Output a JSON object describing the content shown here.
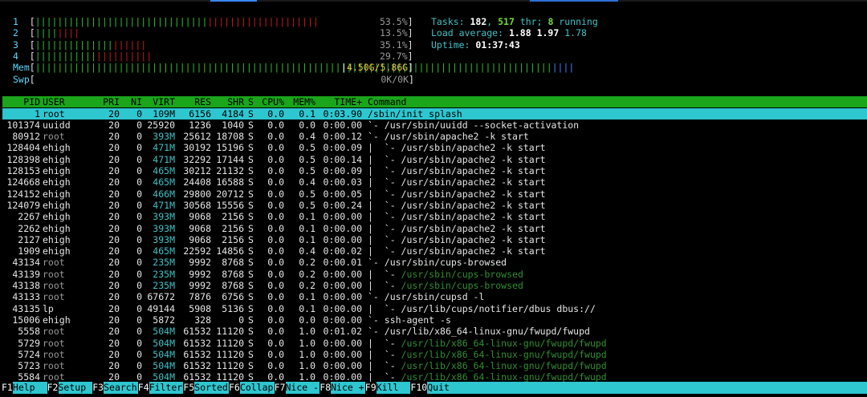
{
  "meters": {
    "cpu1": {
      "label": "1",
      "bars_green": "|||||||||||||||||||||||||||||||",
      "bars_red": "||||||||||||||||||||",
      "pct": "53.5%"
    },
    "cpu2": {
      "label": "2",
      "bars_green": "||||",
      "bars_red": "||||",
      "pct": "13.5%"
    },
    "cpu3": {
      "label": "3",
      "bars_green": "||||||||||||||",
      "bars_red": "||||||",
      "pct": "35.1%"
    },
    "cpu4": {
      "label": "4",
      "bars_green": "|||||||||||",
      "bars_red": "||||||||||",
      "pct": "29.7%"
    },
    "mem": {
      "label": "Mem",
      "bars_green": "|||||||||||||||||||||||||||||||||||||||||||||||||||||||||||||||||||||||||||||||||||||||||||||",
      "bars_blue": "||||",
      "pct": "4.50G/5.86G"
    },
    "swp": {
      "label": "Swp",
      "pct": "0K/0K"
    }
  },
  "summary": {
    "tasks_label": "Tasks: ",
    "tasks": "182",
    "thr_sep": ", ",
    "thr": "517",
    "thr_label": " thr; ",
    "running": "8",
    "running_label": " running",
    "load_label": "Load average: ",
    "load1": "1.88",
    "load5": "1.97",
    "load15": "1.78",
    "uptime_label": "Uptime: ",
    "uptime": "01:37:43"
  },
  "columns": {
    "pid": "PID",
    "user": "USER",
    "pri": "PRI",
    "ni": "NI",
    "virt": "VIRT",
    "res": "RES",
    "shr": "SHR",
    "s": "S",
    "cpu": "CPU%",
    "mem": "MEM%",
    "time": "TIME+",
    "command": "Command"
  },
  "processes": [
    {
      "pid": "1",
      "user": "root",
      "pri": "20",
      "ni": "0",
      "virt": "109M",
      "res": "6156",
      "shr": "4184",
      "s": "S",
      "cpu": "0.0",
      "mem": "0.1",
      "time": "0:03.90",
      "tree": "",
      "cmd": "/sbin/init splash",
      "sel": true
    },
    {
      "pid": "101374",
      "user": "uuidd",
      "pri": "20",
      "ni": "0",
      "virt": "25920",
      "res": "1236",
      "shr": "1040",
      "s": "S",
      "cpu": "0.0",
      "mem": "0.0",
      "time": "0:00.00",
      "tree": "`- ",
      "cmd": "/usr/sbin/uuidd --socket-activation"
    },
    {
      "pid": "80912",
      "user": "root",
      "pri": "20",
      "ni": "0",
      "virt": "393M",
      "res": "25612",
      "shr": "18708",
      "s": "S",
      "cpu": "0.0",
      "mem": "0.4",
      "time": "0:00.12",
      "tree": "`- ",
      "cmd": "/usr/sbin/apache2 -k start"
    },
    {
      "pid": "128404",
      "user": "ehigh",
      "pri": "20",
      "ni": "0",
      "virt": "471M",
      "res": "30192",
      "shr": "15196",
      "s": "S",
      "cpu": "0.0",
      "mem": "0.5",
      "time": "0:00.09",
      "tree": "|  `- ",
      "cmd": "/usr/sbin/apache2 -k start"
    },
    {
      "pid": "128398",
      "user": "ehigh",
      "pri": "20",
      "ni": "0",
      "virt": "471M",
      "res": "32292",
      "shr": "17144",
      "s": "S",
      "cpu": "0.0",
      "mem": "0.5",
      "time": "0:00.14",
      "tree": "|  `- ",
      "cmd": "/usr/sbin/apache2 -k start"
    },
    {
      "pid": "128153",
      "user": "ehigh",
      "pri": "20",
      "ni": "0",
      "virt": "465M",
      "res": "30212",
      "shr": "21132",
      "s": "S",
      "cpu": "0.0",
      "mem": "0.5",
      "time": "0:00.09",
      "tree": "|  `- ",
      "cmd": "/usr/sbin/apache2 -k start"
    },
    {
      "pid": "124668",
      "user": "ehigh",
      "pri": "20",
      "ni": "0",
      "virt": "465M",
      "res": "24408",
      "shr": "16588",
      "s": "S",
      "cpu": "0.0",
      "mem": "0.4",
      "time": "0:00.03",
      "tree": "|  `- ",
      "cmd": "/usr/sbin/apache2 -k start"
    },
    {
      "pid": "124152",
      "user": "ehigh",
      "pri": "20",
      "ni": "0",
      "virt": "466M",
      "res": "29800",
      "shr": "20712",
      "s": "S",
      "cpu": "0.0",
      "mem": "0.5",
      "time": "0:00.05",
      "tree": "|  `- ",
      "cmd": "/usr/sbin/apache2 -k start"
    },
    {
      "pid": "124079",
      "user": "ehigh",
      "pri": "20",
      "ni": "0",
      "virt": "471M",
      "res": "30568",
      "shr": "15556",
      "s": "S",
      "cpu": "0.0",
      "mem": "0.5",
      "time": "0:00.24",
      "tree": "|  `- ",
      "cmd": "/usr/sbin/apache2 -k start"
    },
    {
      "pid": "2267",
      "user": "ehigh",
      "pri": "20",
      "ni": "0",
      "virt": "393M",
      "res": "9068",
      "shr": "2156",
      "s": "S",
      "cpu": "0.0",
      "mem": "0.1",
      "time": "0:00.00",
      "tree": "|  `- ",
      "cmd": "/usr/sbin/apache2 -k start"
    },
    {
      "pid": "2262",
      "user": "ehigh",
      "pri": "20",
      "ni": "0",
      "virt": "393M",
      "res": "9068",
      "shr": "2156",
      "s": "S",
      "cpu": "0.0",
      "mem": "0.1",
      "time": "0:00.00",
      "tree": "|  `- ",
      "cmd": "/usr/sbin/apache2 -k start"
    },
    {
      "pid": "2127",
      "user": "ehigh",
      "pri": "20",
      "ni": "0",
      "virt": "393M",
      "res": "9068",
      "shr": "2156",
      "s": "S",
      "cpu": "0.0",
      "mem": "0.1",
      "time": "0:00.00",
      "tree": "|  `- ",
      "cmd": "/usr/sbin/apache2 -k start"
    },
    {
      "pid": "1909",
      "user": "ehigh",
      "pri": "20",
      "ni": "0",
      "virt": "465M",
      "res": "22592",
      "shr": "14856",
      "s": "S",
      "cpu": "0.0",
      "mem": "0.4",
      "time": "0:00.02",
      "tree": "|  `- ",
      "cmd": "/usr/sbin/apache2 -k start"
    },
    {
      "pid": "43134",
      "user": "root",
      "pri": "20",
      "ni": "0",
      "virt": "235M",
      "res": "9992",
      "shr": "8768",
      "s": "S",
      "cpu": "0.0",
      "mem": "0.2",
      "time": "0:00.01",
      "tree": "`- ",
      "cmd": "/usr/sbin/cups-browsed"
    },
    {
      "pid": "43139",
      "user": "root",
      "pri": "20",
      "ni": "0",
      "virt": "235M",
      "res": "9992",
      "shr": "8768",
      "s": "S",
      "cpu": "0.0",
      "mem": "0.2",
      "time": "0:00.00",
      "tree": "|  `- ",
      "cmd": "/usr/sbin/cups-browsed",
      "thread": true
    },
    {
      "pid": "43138",
      "user": "root",
      "pri": "20",
      "ni": "0",
      "virt": "235M",
      "res": "9992",
      "shr": "8768",
      "s": "S",
      "cpu": "0.0",
      "mem": "0.2",
      "time": "0:00.00",
      "tree": "|  `- ",
      "cmd": "/usr/sbin/cups-browsed",
      "thread": true
    },
    {
      "pid": "43133",
      "user": "root",
      "pri": "20",
      "ni": "0",
      "virt": "67672",
      "res": "7876",
      "shr": "6756",
      "s": "S",
      "cpu": "0.0",
      "mem": "0.1",
      "time": "0:00.00",
      "tree": "`- ",
      "cmd": "/usr/sbin/cupsd -l"
    },
    {
      "pid": "43135",
      "user": "lp",
      "pri": "20",
      "ni": "0",
      "virt": "49144",
      "res": "5908",
      "shr": "5136",
      "s": "S",
      "cpu": "0.0",
      "mem": "0.1",
      "time": "0:00.00",
      "tree": "|  `- ",
      "cmd": "/usr/lib/cups/notifier/dbus dbus://"
    },
    {
      "pid": "15006",
      "user": "ehigh",
      "pri": "20",
      "ni": "0",
      "virt": "5872",
      "res": "328",
      "shr": "0",
      "s": "S",
      "cpu": "0.0",
      "mem": "0.0",
      "time": "0:00.00",
      "tree": "`- ",
      "cmd": "ssh-agent -s"
    },
    {
      "pid": "5558",
      "user": "root",
      "pri": "20",
      "ni": "0",
      "virt": "504M",
      "res": "61532",
      "shr": "11120",
      "s": "S",
      "cpu": "0.0",
      "mem": "1.0",
      "time": "0:01.02",
      "tree": "`- ",
      "cmd": "/usr/lib/x86_64-linux-gnu/fwupd/fwupd"
    },
    {
      "pid": "5729",
      "user": "root",
      "pri": "20",
      "ni": "0",
      "virt": "504M",
      "res": "61532",
      "shr": "11120",
      "s": "S",
      "cpu": "0.0",
      "mem": "1.0",
      "time": "0:00.00",
      "tree": "|  `- ",
      "cmd": "/usr/lib/x86_64-linux-gnu/fwupd/fwupd",
      "thread": true
    },
    {
      "pid": "5724",
      "user": "root",
      "pri": "20",
      "ni": "0",
      "virt": "504M",
      "res": "61532",
      "shr": "11120",
      "s": "S",
      "cpu": "0.0",
      "mem": "1.0",
      "time": "0:00.00",
      "tree": "|  `- ",
      "cmd": "/usr/lib/x86_64-linux-gnu/fwupd/fwupd",
      "thread": true
    },
    {
      "pid": "5723",
      "user": "root",
      "pri": "20",
      "ni": "0",
      "virt": "504M",
      "res": "61532",
      "shr": "11120",
      "s": "S",
      "cpu": "0.0",
      "mem": "1.0",
      "time": "0:00.00",
      "tree": "|  `- ",
      "cmd": "/usr/lib/x86_64-linux-gnu/fwupd/fwupd",
      "thread": true
    },
    {
      "pid": "5584",
      "user": "root",
      "pri": "20",
      "ni": "0",
      "virt": "504M",
      "res": "61532",
      "shr": "11120",
      "s": "S",
      "cpu": "0.0",
      "mem": "1.0",
      "time": "0:00.00",
      "tree": "|  `- ",
      "cmd": "/usr/lib/x86_64-linux-gnu/fwupd/fwupd",
      "thread": true
    }
  ],
  "function_keys": [
    {
      "key": "F1",
      "label": "Help"
    },
    {
      "key": "F2",
      "label": "Setup"
    },
    {
      "key": "F3",
      "label": "Search"
    },
    {
      "key": "F4",
      "label": "Filter"
    },
    {
      "key": "F5",
      "label": "Sorted"
    },
    {
      "key": "F6",
      "label": "Collap"
    },
    {
      "key": "F7",
      "label": "Nice -"
    },
    {
      "key": "F8",
      "label": "Nice +"
    },
    {
      "key": "F9",
      "label": "Kill"
    },
    {
      "key": "F10",
      "label": "Quit"
    }
  ],
  "colors": {
    "header_bg": "#1aa51a",
    "selected_bg": "#2ec6cf",
    "fkey_bg": "#2ec6cf",
    "cyan": "#41c1c6",
    "thread": "#2f8f2f"
  }
}
